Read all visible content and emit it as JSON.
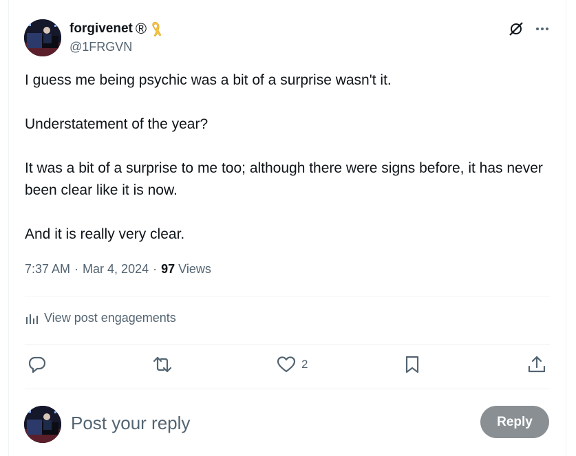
{
  "author": {
    "display_name": "forgivenet",
    "name_symbol": "®",
    "handle": "@1FRGVN"
  },
  "post": {
    "paragraphs": [
      "I guess me being psychic was a bit of a surprise wasn't it.",
      "Understatement of the year?",
      "It was a bit of a surprise to me too; although there were signs before, it has never been clear like it is now.",
      "And it is really very clear."
    ],
    "time": "7:37 AM",
    "date": "Mar 4, 2024",
    "views_count": "97",
    "views_label": "Views"
  },
  "engagements": {
    "label": "View post engagements"
  },
  "actions": {
    "like_count": "2"
  },
  "reply": {
    "placeholder": "Post your reply",
    "button_label": "Reply"
  },
  "colors": {
    "text_primary": "#0f1419",
    "text_secondary": "#536471",
    "divider": "#eff3f4",
    "reply_button_disabled": "#8a8f93",
    "ribbon": "#f5c542"
  },
  "icons": {
    "top_right": [
      "grok-icon",
      "more-icon"
    ],
    "actions": [
      "reply-icon",
      "repost-icon",
      "like-icon",
      "bookmark-icon",
      "share-icon"
    ]
  }
}
